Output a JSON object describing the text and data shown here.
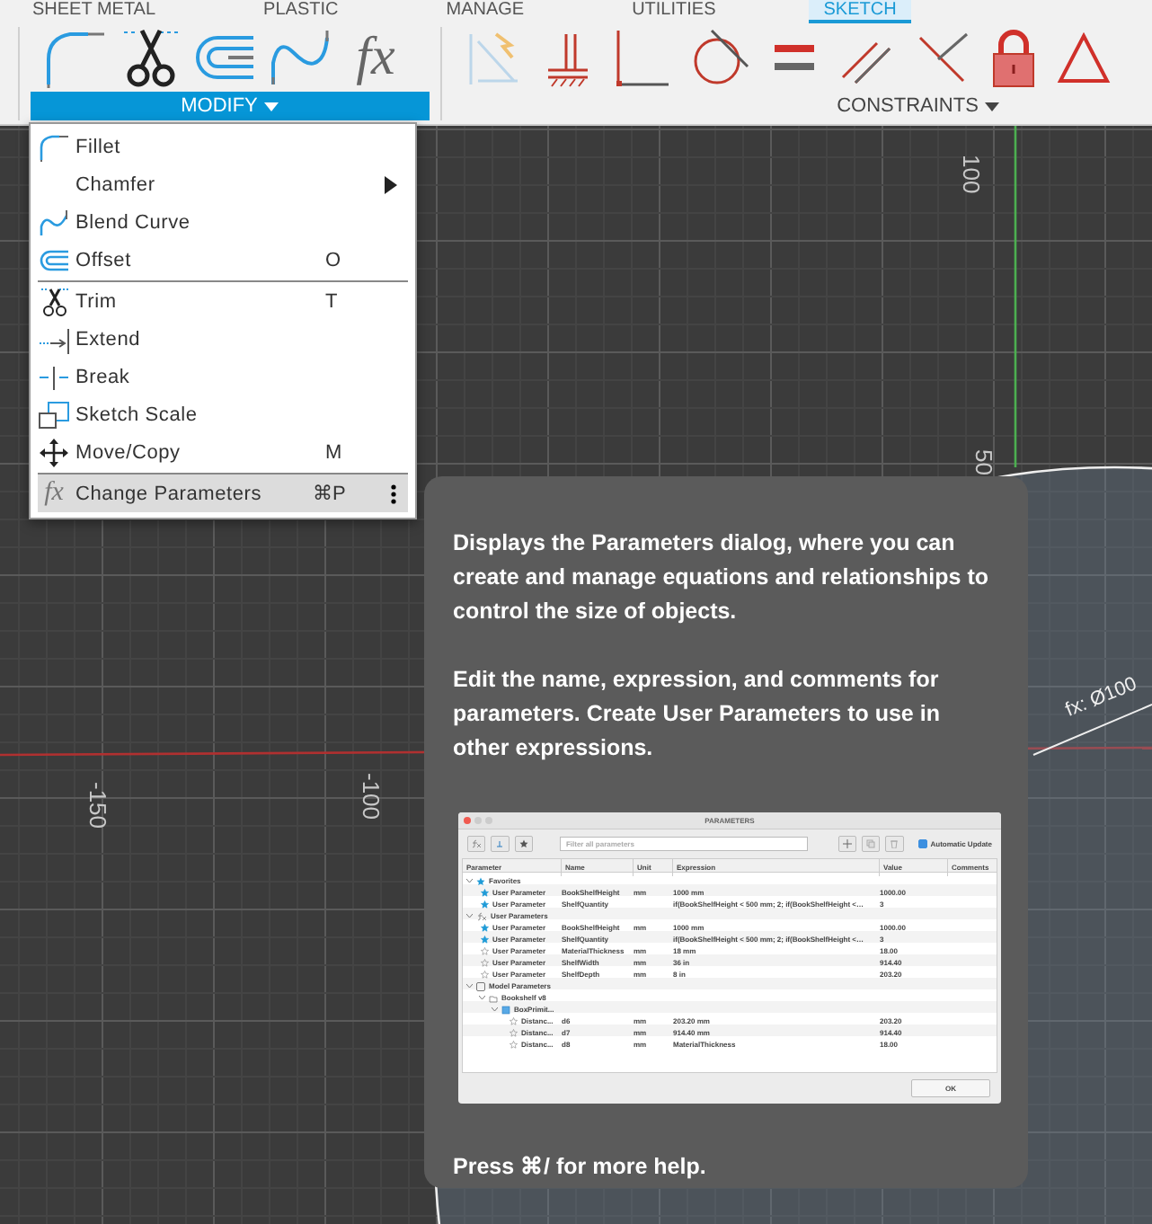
{
  "ribbon_tabs": [
    {
      "label": "SHEET METAL",
      "selected": false
    },
    {
      "label": "PLASTIC",
      "selected": false
    },
    {
      "label": "MANAGE",
      "selected": false
    },
    {
      "label": "UTILITIES",
      "selected": false
    },
    {
      "label": "SKETCH",
      "selected": true
    }
  ],
  "panels": [
    {
      "label": "MODIFY",
      "open": true,
      "tool_glyph": "fx"
    },
    {
      "label": "CONSTRAINTS",
      "open": false
    }
  ],
  "modify_menu": {
    "groups": [
      [
        {
          "label": "Fillet",
          "submenu": false,
          "selected": false
        },
        {
          "label": "Chamfer",
          "submenu": true,
          "selected": false
        },
        {
          "label": "Blend Curve",
          "submenu": false,
          "selected": false
        },
        {
          "label": "Offset",
          "shortcut": "O",
          "submenu": false,
          "selected": false
        }
      ],
      [
        {
          "label": "Trim",
          "shortcut": "T",
          "submenu": false,
          "selected": false
        },
        {
          "label": "Extend",
          "submenu": false,
          "selected": false
        },
        {
          "label": "Break",
          "submenu": false,
          "selected": false
        },
        {
          "label": "Sketch Scale",
          "submenu": false,
          "selected": false
        },
        {
          "label": "Move/Copy",
          "shortcut": "M",
          "submenu": false,
          "selected": false
        }
      ],
      [
        {
          "label": "Change Parameters",
          "glyph": "fx",
          "shortcut": "⌘P",
          "submenu": false,
          "selected": true
        }
      ]
    ]
  },
  "tooltip": {
    "paragraphs": [
      "Displays the Parameters dialog, where you can create and manage equations and relationships to control the size of objects.",
      "Edit the name, expression, and comments for parameters. Create User Parameters to use in other expressions."
    ],
    "dialog": {
      "title": "PARAMETERS",
      "search": {
        "placeholder": "Filter all parameters"
      },
      "auto_update": {
        "label": "Automatic Update",
        "checked": true
      },
      "columns": [
        "Parameter",
        "Name",
        "Unit",
        "Expression",
        "Value",
        "Comments"
      ],
      "tree": [
        {
          "label": "Favorites",
          "children": [
            {
              "parameter": "User Parameter",
              "name": "BookShelfHeight",
              "unit": "mm",
              "expression": "1000 mm",
              "value": "1000.00",
              "favorite": true
            },
            {
              "parameter": "User Parameter",
              "name": "ShelfQuantity",
              "expression": "if(BookShelfHeight < 500 mm; 2; if(BookShelfHeight <…",
              "value": "3",
              "favorite": true
            }
          ]
        },
        {
          "label": "User Parameters",
          "children": [
            {
              "parameter": "User Parameter",
              "name": "BookShelfHeight",
              "unit": "mm",
              "expression": "1000 mm",
              "value": "1000.00",
              "favorite": true
            },
            {
              "parameter": "User Parameter",
              "name": "ShelfQuantity",
              "expression": "if(BookShelfHeight < 500 mm; 2; if(BookShelfHeight <…",
              "value": "3",
              "favorite": true
            },
            {
              "parameter": "User Parameter",
              "name": "MaterialThickness",
              "unit": "mm",
              "expression": "18 mm",
              "value": "18.00",
              "favorite": false
            },
            {
              "parameter": "User Parameter",
              "name": "ShelfWidth",
              "unit": "mm",
              "expression": "36 in",
              "value": "914.40",
              "favorite": false
            },
            {
              "parameter": "User Parameter",
              "name": "ShelfDepth",
              "unit": "mm",
              "expression": "8 in",
              "value": "203.20",
              "favorite": false
            }
          ]
        },
        {
          "label": "Model Parameters",
          "children": [
            {
              "label": "Bookshelf v8",
              "children": [
                {
                  "label": "BoxPrimit...",
                  "children": [
                    {
                      "parameter": "Distanc...",
                      "name": "d6",
                      "unit": "mm",
                      "expression": "203.20 mm",
                      "value": "203.20",
                      "favorite": false
                    },
                    {
                      "parameter": "Distanc...",
                      "name": "d7",
                      "unit": "mm",
                      "expression": "914.40 mm",
                      "value": "914.40",
                      "favorite": false
                    },
                    {
                      "parameter": "Distanc...",
                      "name": "d8",
                      "unit": "mm",
                      "expression": "MaterialThickness",
                      "value": "18.00",
                      "favorite": false
                    }
                  ]
                }
              ]
            }
          ]
        }
      ],
      "ok_button": "OK"
    },
    "footer": "Press ⌘/ for more help."
  },
  "canvas": {
    "axis_labels": [
      "100",
      "50",
      "-150",
      "-100"
    ],
    "dimension": "fx: Ø100"
  }
}
